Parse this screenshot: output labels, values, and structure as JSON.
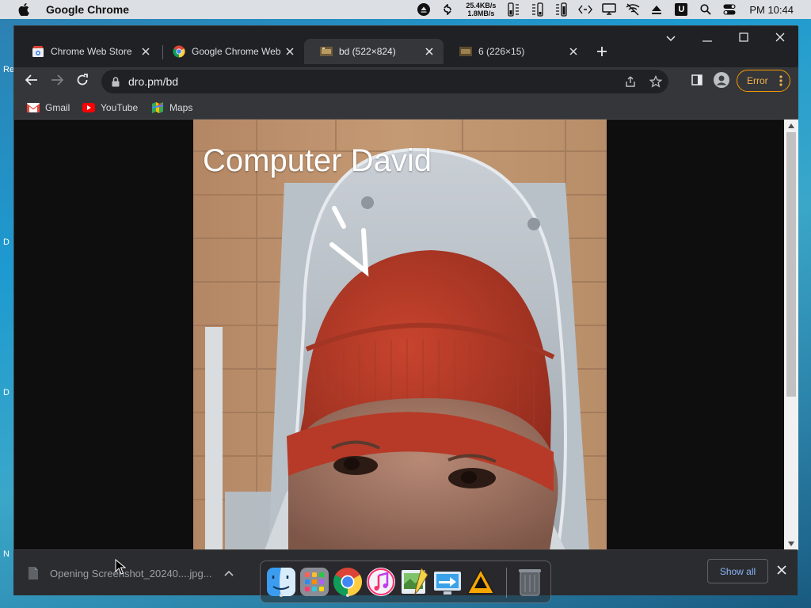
{
  "menubar": {
    "app_name": "Google Chrome",
    "net_up": "25.4KB/s",
    "net_down": "1.8MB/s",
    "clock": "PM 10:44",
    "badge": "U"
  },
  "desktop": {
    "edge_letters": [
      "Re",
      "D",
      "D",
      "N"
    ]
  },
  "tabs": [
    {
      "title": "Chrome Web Store",
      "favicon": "web-store-icon",
      "active": false
    },
    {
      "title": "Google Chrome Web",
      "favicon": "chrome-icon",
      "active": false
    },
    {
      "title": "bd (522×824)",
      "favicon": "image-thumb-icon",
      "active": true
    },
    {
      "title": "6 (226×15)",
      "favicon": "image-thumb-icon",
      "active": false
    }
  ],
  "toolbar": {
    "url": "dro.pm/bd",
    "error_label": "Error"
  },
  "bookmarks": [
    {
      "label": "Gmail",
      "icon": "gmail-icon"
    },
    {
      "label": "YouTube",
      "icon": "youtube-icon"
    },
    {
      "label": "Maps",
      "icon": "maps-icon"
    }
  ],
  "page": {
    "image_caption": "Computer David"
  },
  "downloads": {
    "item_label": "Opening Screenshot_20240....jpg...",
    "show_all": "Show all"
  },
  "dock": {
    "apps": [
      "finder-icon",
      "launchpad-icon",
      "chrome-icon",
      "music-icon",
      "preview-icon",
      "migration-icon",
      "vlc-icon",
      "trash-icon"
    ]
  },
  "colors": {
    "accent_error": "#f29900",
    "link_blue": "#8ab4f8",
    "chrome_dark": "#202124",
    "toolbar_gray": "#35363a"
  }
}
